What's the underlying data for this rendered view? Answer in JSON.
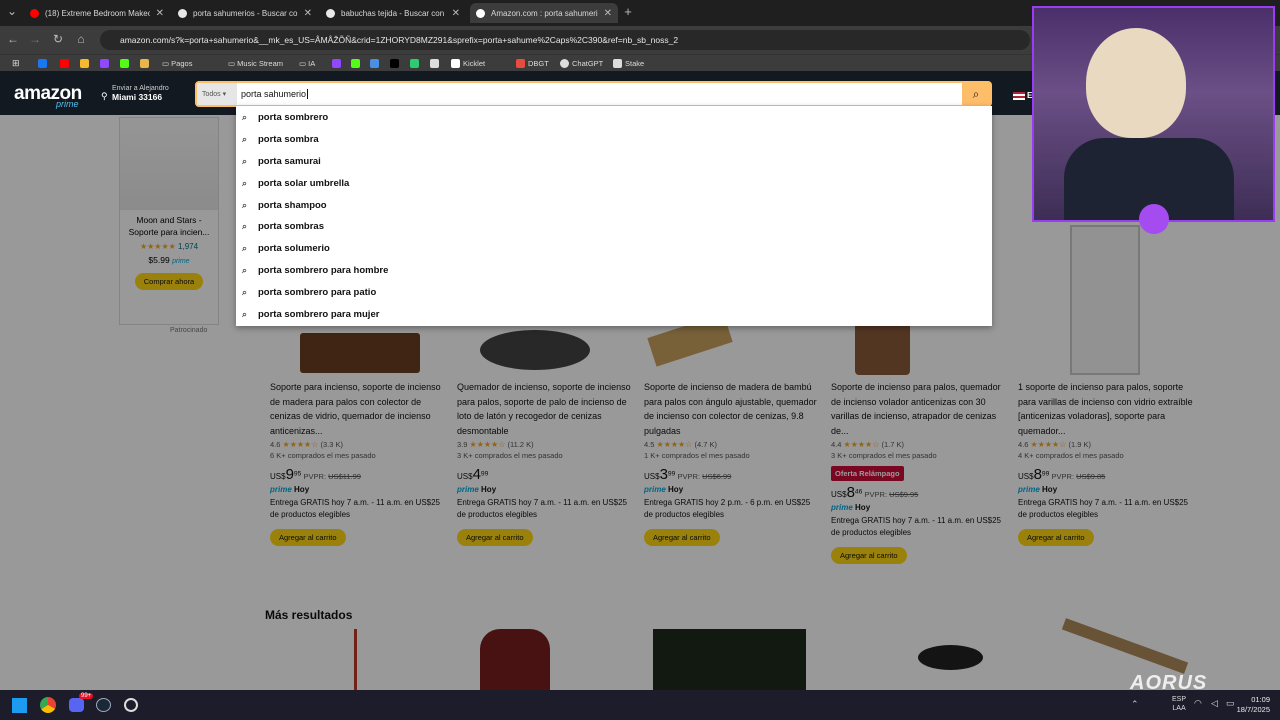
{
  "browser": {
    "tabs": [
      {
        "title": "(18) Extreme Bedroom Makeov",
        "icon_color": "#ff0000",
        "icon": "youtube-icon"
      },
      {
        "title": "porta sahumerios - Buscar con C",
        "icon_color": "#e8e8e8",
        "icon": "google-icon"
      },
      {
        "title": "babuchas tejida - Buscar con G",
        "icon_color": "#e8e8e8",
        "icon": "google-icon"
      },
      {
        "title": "Amazon.com : porta sahumerio",
        "icon_color": "#ffffff",
        "icon": "amazon-icon"
      }
    ],
    "new_tab_label": "+",
    "url": "amazon.com/s?k=porta+sahumerio&__mk_es_US=ÅMÅŽÕÑ&crid=1ZHORYD8MZ291&sprefix=porta+sahume%2Caps%2C390&ref=nb_sb_noss_2",
    "bookmarks": [
      {
        "label": "",
        "color": "#1877f2"
      },
      {
        "label": "",
        "color": "#ff0000"
      },
      {
        "label": "",
        "color": "#f3ba2f"
      },
      {
        "label": "",
        "color": "#9146ff"
      },
      {
        "label": "",
        "color": "#53fc18"
      },
      {
        "label": "",
        "color": "#e9b64b"
      },
      {
        "label": "Pagos",
        "color": "#888888"
      },
      {
        "label": "Music Stream",
        "color": "#888888"
      },
      {
        "label": "IA",
        "color": "#888888"
      },
      {
        "label": "",
        "color": "#9146ff"
      },
      {
        "label": "",
        "color": "#53fc18"
      },
      {
        "label": "",
        "color": "#4a90e2"
      },
      {
        "label": "",
        "color": "#000000"
      },
      {
        "label": "",
        "color": "#2ecc71"
      },
      {
        "label": "",
        "color": "#ffffff"
      },
      {
        "label": "Kicklet",
        "color": "#ffffff"
      },
      {
        "label": "DBGT",
        "color": "#e74c3c"
      },
      {
        "label": "ChatGPT",
        "color": "#dddddd"
      },
      {
        "label": "Stake",
        "color": "#dddddd"
      }
    ]
  },
  "amazon": {
    "logo": "amazon",
    "prime": "prime",
    "deliver_line1": "Enviar a Alejandro",
    "deliver_line2": "Miami 33166",
    "search_category": "Todos",
    "search_value": "porta sahumerio",
    "flag_text": "E"
  },
  "suggestions": [
    "porta sombrero",
    "porta sombra",
    "porta samurai",
    "porta solar umbrella",
    "porta shampoo",
    "porta sombras",
    "porta solumerio",
    "porta sombrero para hombre",
    "porta sombrero para patio",
    "porta sombrero para mujer"
  ],
  "left_ad": {
    "title": "Moon and Stars - Soporte para incien...",
    "stars": "★★★★★",
    "rating_count": "1,974",
    "price": "$5.99",
    "prime_tag": "prime",
    "button": "Comprar ahora",
    "sponsored": "Patrocinado"
  },
  "products": [
    {
      "title": "Soporte para incienso, soporte de incienso de madera para palos con colector de cenizas de vidrio, quemador de incienso anticenizas...",
      "rating": "4.6",
      "stars": "★★★★☆",
      "reviews": "(3.3 K)",
      "bought": "6 K+ comprados el mes pasado",
      "currency": "US$",
      "price_int": "9",
      "price_dec": "95",
      "pvpr_label": "PVPR:",
      "pvpr": "US$11.99",
      "prime_day": "Hoy",
      "delivery": "Entrega GRATIS hoy 7 a.m. - 11 a.m. en US$25 de productos elegibles",
      "add": "Agregar al carrito",
      "flash": ""
    },
    {
      "title": "Quemador de incienso, soporte de incienso para palos, soporte de palo de incienso de loto de latón y recogedor de cenizas desmontable",
      "rating": "3.9",
      "stars": "★★★★☆",
      "reviews": "(11.2 K)",
      "bought": "3 K+ comprados el mes pasado",
      "currency": "US$",
      "price_int": "4",
      "price_dec": "99",
      "pvpr_label": "",
      "pvpr": "",
      "prime_day": "Hoy",
      "delivery": "Entrega GRATIS hoy 7 a.m. - 11 a.m. en US$25 de productos elegibles",
      "add": "Agregar al carrito",
      "flash": ""
    },
    {
      "title": "Soporte de incienso de madera de bambú para palos con ángulo ajustable, quemador de incienso con colector de cenizas, 9.8 pulgadas",
      "rating": "4.5",
      "stars": "★★★★☆",
      "reviews": "(4.7 K)",
      "bought": "1 K+ comprados el mes pasado",
      "currency": "US$",
      "price_int": "3",
      "price_dec": "99",
      "pvpr_label": "PVPR:",
      "pvpr": "US$6.99",
      "prime_day": "Hoy",
      "delivery": "Entrega GRATIS hoy 2 p.m. - 6 p.m. en US$25 de productos elegibles",
      "add": "Agregar al carrito",
      "flash": ""
    },
    {
      "title": "Soporte de incienso para palos, quemador de incienso volador anticenizas con 30 varillas de incienso, atrapador de cenizas de...",
      "rating": "4.4",
      "stars": "★★★★☆",
      "reviews": "(1.7 K)",
      "bought": "3 K+ comprados el mes pasado",
      "currency": "US$",
      "price_int": "8",
      "price_dec": "46",
      "pvpr_label": "PVPR:",
      "pvpr": "US$9.95",
      "prime_day": "Hoy",
      "delivery": "Entrega GRATIS hoy 7 a.m. - 11 a.m. en US$25 de productos elegibles",
      "add": "Agregar al carrito",
      "flash": "Oferta Relámpago"
    },
    {
      "title": "1 soporte de incienso para palos, soporte para varillas de incienso con vidrio extraíble [anticenizas voladoras], soporte para quemador...",
      "rating": "4.6",
      "stars": "★★★★☆",
      "reviews": "(1.9 K)",
      "bought": "4 K+ comprados el mes pasado",
      "currency": "US$",
      "price_int": "8",
      "price_dec": "99",
      "pvpr_label": "PVPR:",
      "pvpr": "US$9.85",
      "prime_day": "Hoy",
      "delivery": "Entrega GRATIS hoy 7 a.m. - 11 a.m. en US$25 de productos elegibles",
      "add": "Agregar al carrito",
      "flash": ""
    }
  ],
  "more_results": "Más resultados",
  "taskbar": {
    "brand": "AORUS",
    "lang1": "ESP",
    "lang2": "LAA",
    "time": "01:09",
    "date": "18/7/2025",
    "badge": "99+"
  }
}
